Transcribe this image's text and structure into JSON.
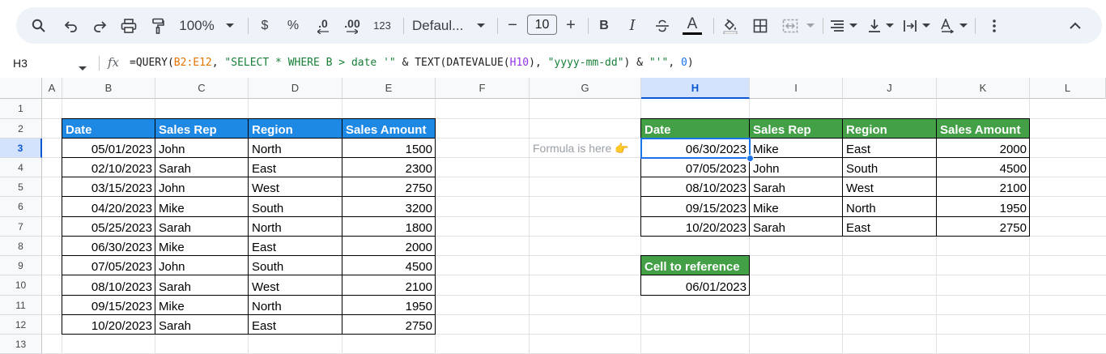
{
  "toolbar": {
    "zoom": "100%",
    "currency": "$",
    "percent": "%",
    "dec_decrease": ".0",
    "dec_increase": ".00",
    "number_format": "123",
    "font": "Defaul...",
    "font_size": "10",
    "minus": "−",
    "plus": "+",
    "bold": "B",
    "italic": "I",
    "text_color": "A",
    "icons": [
      "search-icon",
      "undo-icon",
      "redo-icon",
      "print-icon",
      "paint-format-icon",
      "fill-color-icon",
      "borders-icon",
      "merge-cells-icon",
      "align-icon",
      "valign-icon",
      "text-wrap-icon",
      "text-rotate-icon",
      "more-icon",
      "collapse-icon"
    ]
  },
  "formula_bar": {
    "cell_ref": "H3",
    "fx": "fx",
    "formula": {
      "p1": "=QUERY(",
      "range": "B2:E12",
      "p2": ", ",
      "str1": "\"SELECT * WHERE B > date '\"",
      "p3": " & TEXT(DATEVALUE(",
      "ref": "H10",
      "p4": "), ",
      "str2": "\"yyyy-mm-dd\"",
      "p5": ") & ",
      "str3": "\"'\"",
      "p6": ", ",
      "num": "0",
      "p7": ")"
    }
  },
  "columns": [
    "A",
    "B",
    "C",
    "D",
    "E",
    "F",
    "G",
    "H",
    "I",
    "J",
    "K",
    "L"
  ],
  "rows": [
    "1",
    "2",
    "3",
    "4",
    "5",
    "6",
    "7",
    "8",
    "9",
    "10",
    "11",
    "12",
    "13"
  ],
  "selected_column": "H",
  "selected_row": "3",
  "source_table": {
    "headers": [
      "Date",
      "Sales Rep",
      "Region",
      "Sales Amount"
    ],
    "rows": [
      [
        "05/01/2023",
        "John",
        "North",
        "1500"
      ],
      [
        "02/10/2023",
        "Sarah",
        "East",
        "2300"
      ],
      [
        "03/15/2023",
        "John",
        "West",
        "2750"
      ],
      [
        "04/20/2023",
        "Mike",
        "South",
        "3200"
      ],
      [
        "05/25/2023",
        "Sarah",
        "North",
        "1800"
      ],
      [
        "06/30/2023",
        "Mike",
        "East",
        "2000"
      ],
      [
        "07/05/2023",
        "John",
        "South",
        "4500"
      ],
      [
        "08/10/2023",
        "Sarah",
        "West",
        "2100"
      ],
      [
        "09/15/2023",
        "Mike",
        "North",
        "1950"
      ],
      [
        "10/20/2023",
        "Sarah",
        "East",
        "2750"
      ]
    ]
  },
  "note": "Formula is here 👉",
  "result_table": {
    "headers": [
      "Date",
      "Sales Rep",
      "Region",
      "Sales Amount"
    ],
    "rows": [
      [
        "06/30/2023",
        "Mike",
        "East",
        "2000"
      ],
      [
        "07/05/2023",
        "John",
        "South",
        "4500"
      ],
      [
        "08/10/2023",
        "Sarah",
        "West",
        "2100"
      ],
      [
        "09/15/2023",
        "Mike",
        "North",
        "1950"
      ],
      [
        "10/20/2023",
        "Sarah",
        "East",
        "2750"
      ]
    ]
  },
  "reference": {
    "label": "Cell to reference",
    "value": "06/01/2023"
  },
  "colors": {
    "blue_header": "#1e88e5",
    "green_header": "#43a047",
    "selection": "#1a73e8"
  }
}
